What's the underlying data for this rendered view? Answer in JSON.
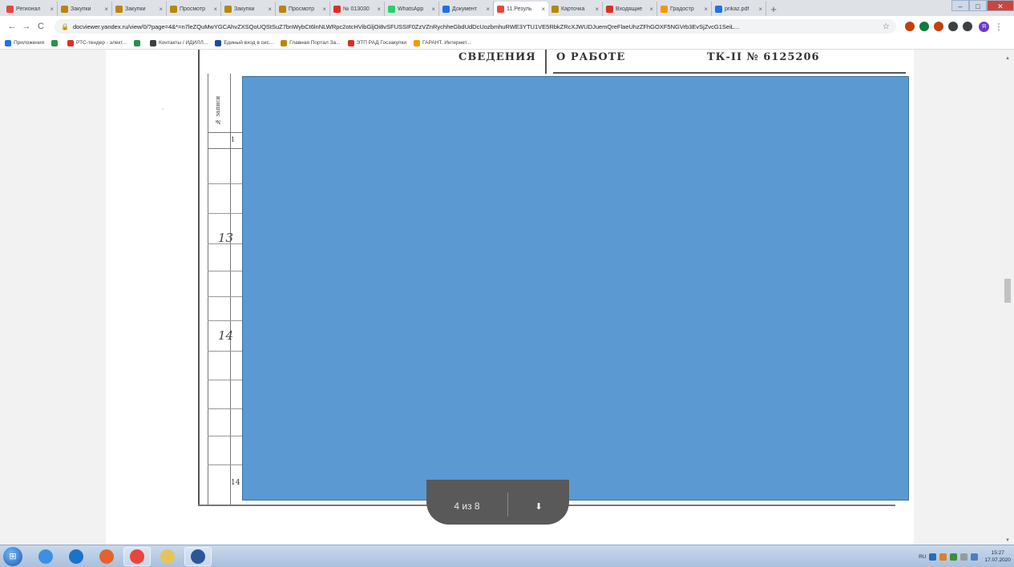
{
  "browser": {
    "tabs": [
      {
        "label": "Регионал",
        "color": "#e8453c"
      },
      {
        "label": "Закупки",
        "color": "#b8860b"
      },
      {
        "label": "Закупки",
        "color": "#b8860b"
      },
      {
        "label": "Просмотр",
        "color": "#b8860b"
      },
      {
        "label": "Закупки",
        "color": "#b8860b"
      },
      {
        "label": "Просмотр",
        "color": "#b8860b"
      },
      {
        "label": "№ 013030",
        "color": "#d93025"
      },
      {
        "label": "WhatsApp",
        "color": "#25d366"
      },
      {
        "label": "Документ",
        "color": "#1a73e8"
      },
      {
        "label": "11.Резуль",
        "color": "#e8453c",
        "active": true
      },
      {
        "label": "Карточка",
        "color": "#b8860b"
      },
      {
        "label": "Входящие",
        "color": "#d93025"
      },
      {
        "label": "Градостр",
        "color": "#f29900"
      },
      {
        "label": "prikaz.pdf",
        "color": "#1a73e8"
      }
    ],
    "tab_close": "×",
    "new_tab": "+",
    "window_controls": {
      "minimize": "–",
      "maximize": "□",
      "close": "✕"
    },
    "nav": {
      "back": "←",
      "forward": "→",
      "reload": "C"
    },
    "address": "docviewer.yandex.ru/view/0/?page=4&*=n7leZQuMwYGCAhvZXSQoUQStSuZ7bnWybCt6lnNLWRpc2otcHVibGljOi8vSFUSSIF0ZzVZnRychheGbdUdDcUozbmhuRWE3YTU1VE5RbkZRcXJWUDJuemQreFlaeUhzZFhGOXF5NGVrb3EvSjZvcG1SeiL...",
    "lock_icon": "🔒",
    "star": "☆",
    "extensions": [
      "#c2410c",
      "#0b7a3e",
      "#c2410c",
      "#3c4043",
      "#3c4043"
    ],
    "profile_letter": "Я",
    "bookmarks": [
      {
        "label": "Приложения",
        "color": "#1a73e8"
      },
      {
        "label": "",
        "color": "#2a8f4b"
      },
      {
        "label": "РТС-тендер - элект...",
        "color": "#d93025"
      },
      {
        "label": "",
        "color": "#2a8f4b"
      },
      {
        "label": "Контакты / ИДИЛЛ...",
        "color": "#3c4043"
      },
      {
        "label": "Единый вход в сис...",
        "color": "#1a4fa0"
      },
      {
        "label": "Главная Портал За...",
        "color": "#b8860b"
      },
      {
        "label": "ЭТП РАД Госзакупки",
        "color": "#d93025"
      },
      {
        "label": "ГАРАНТ. Интернет...",
        "color": "#f29900"
      }
    ]
  },
  "document": {
    "header_left": "СВЕДЕНИЯ",
    "header_mid": "О РАБОТЕ",
    "header_right": "ТК-II № 6125206",
    "col_number_header": "№ записи",
    "row_one": "1",
    "entry_13": "13",
    "entry_14": "14",
    "entry_14_print": "14"
  },
  "viewer": {
    "page_indicator": "4 из 8",
    "download_icon": "⬇"
  },
  "taskbar": {
    "apps": [
      {
        "name": "ie",
        "color": "#3d8fe0",
        "open": false
      },
      {
        "name": "skype",
        "color": "#1a73c8",
        "open": false
      },
      {
        "name": "firefox",
        "color": "#e6622a",
        "open": false
      },
      {
        "name": "chrome",
        "color": "#e8453c",
        "open": true
      },
      {
        "name": "folder",
        "color": "#e7c45a",
        "open": false
      },
      {
        "name": "word",
        "color": "#2b5797",
        "open": true
      }
    ],
    "tray_lang": "RU",
    "time": "15:27",
    "date": "17.07.2020"
  }
}
